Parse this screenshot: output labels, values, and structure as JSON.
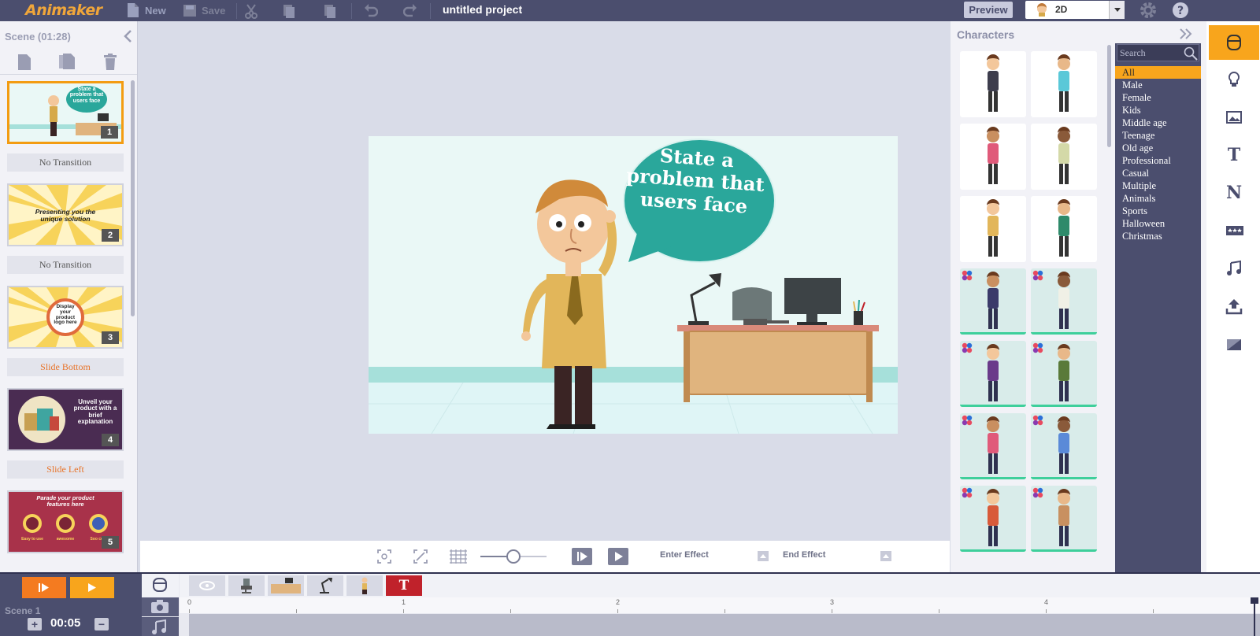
{
  "app": {
    "logo": "Animaker",
    "project_title": "untitled project"
  },
  "toolbar": {
    "new_label": "New",
    "save_label": "Save",
    "preview_label": "Preview",
    "mode_value": "2D"
  },
  "scenes_panel": {
    "header": "Scene  (01:28)",
    "scenes": [
      {
        "number": "1",
        "text": "State a problem that users face"
      },
      {
        "number": "2",
        "text": "Presenting you the unique solution"
      },
      {
        "number": "3",
        "text": "Display your product logo here"
      },
      {
        "number": "4",
        "text": "Unveil your product with a brief explanation"
      },
      {
        "number": "5",
        "text": "Parade your product features here",
        "features": [
          "Easy to use",
          "awesome",
          "Soo cool"
        ]
      }
    ],
    "transitions": [
      "No Transition",
      "No Transition",
      "Slide Bottom",
      "Slide Left"
    ]
  },
  "canvas": {
    "bubble_text": "State a problem that users face"
  },
  "stage_controls": {
    "zoom_level": 0.5,
    "enter_effect_label": "Enter Effect",
    "end_effect_label": "End Effect"
  },
  "characters_panel": {
    "title": "Characters",
    "search_placeholder": "Search",
    "categories": [
      "All",
      "Male",
      "Female",
      "Kids",
      "Middle age",
      "Teenage",
      "Old age",
      "Professional",
      "Casual",
      "Multiple",
      "Animals",
      "Sports",
      "Halloween",
      "Christmas"
    ],
    "selected_category": "All",
    "characters": [
      {
        "name": "businesswoman",
        "colored": false
      },
      {
        "name": "nurse",
        "colored": false
      },
      {
        "name": "girl",
        "colored": false
      },
      {
        "name": "mummy",
        "colored": false
      },
      {
        "name": "office-man",
        "colored": false
      },
      {
        "name": "boy",
        "colored": false
      },
      {
        "name": "woman-hijab",
        "colored": true
      },
      {
        "name": "arab-man",
        "colored": true
      },
      {
        "name": "indian-woman",
        "colored": true
      },
      {
        "name": "african-man",
        "colored": true
      },
      {
        "name": "chinese-woman",
        "colored": true
      },
      {
        "name": "man-blue-shirt",
        "colored": true
      },
      {
        "name": "woman-saree",
        "colored": true
      },
      {
        "name": "man-kurta",
        "colored": true
      }
    ]
  },
  "timeline": {
    "scene_label": "Scene 1",
    "duration": "00:05",
    "plus_label": "+",
    "minus_label": "−",
    "ruler_labels": [
      "0",
      "1",
      "2",
      "3",
      "4"
    ],
    "text_object_label": "T"
  },
  "colors": {
    "accent": "#f8a51c",
    "topbar": "#4b4e6e",
    "bubble": "#2aa79b",
    "play": "#f47b20"
  }
}
